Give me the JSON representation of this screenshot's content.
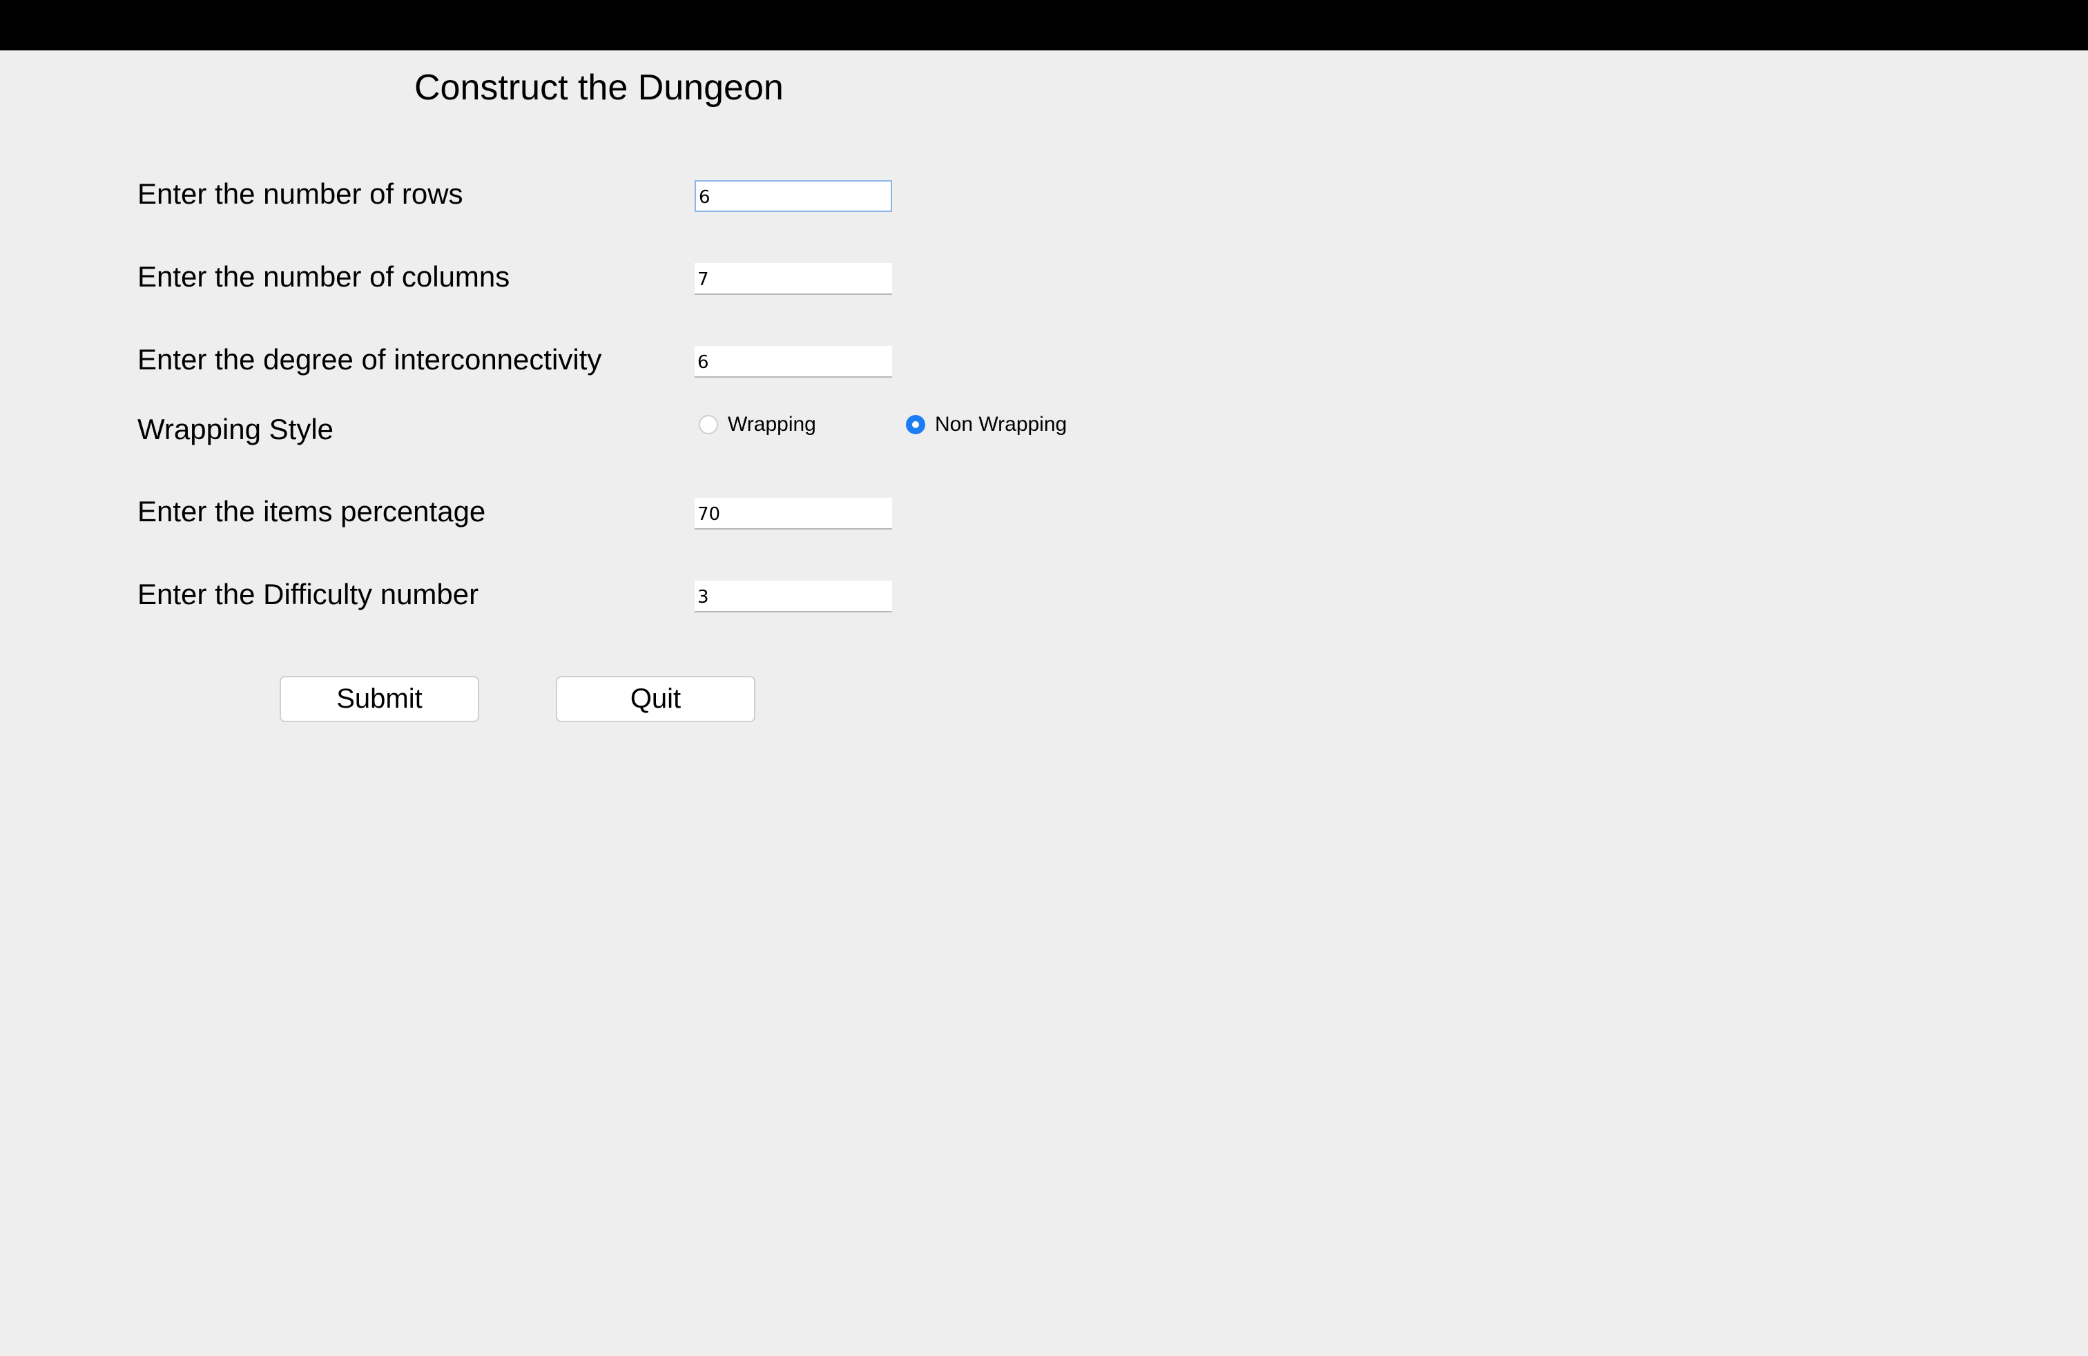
{
  "window": {
    "title": "Construct the Dungeon"
  },
  "form": {
    "rows": {
      "label": "Enter the number of rows",
      "value": "6"
    },
    "columns": {
      "label": "Enter the number of columns",
      "value": "7"
    },
    "interconnectivity": {
      "label": "Enter the degree of interconnectivity",
      "value": "6"
    },
    "wrapping": {
      "label": "Wrapping Style",
      "options": [
        {
          "label": "Wrapping",
          "selected": false
        },
        {
          "label": "Non Wrapping",
          "selected": true
        }
      ]
    },
    "items": {
      "label": "Enter the items percentage",
      "value": "70"
    },
    "difficulty": {
      "label": "Enter the Difficulty number",
      "value": "3"
    }
  },
  "buttons": {
    "submit": "Submit",
    "quit": "Quit"
  },
  "colors": {
    "background": "#eeeeee",
    "top_bar": "#000000",
    "radio_selected": "#1d7cf2",
    "focus_border": "#8db6e8"
  }
}
